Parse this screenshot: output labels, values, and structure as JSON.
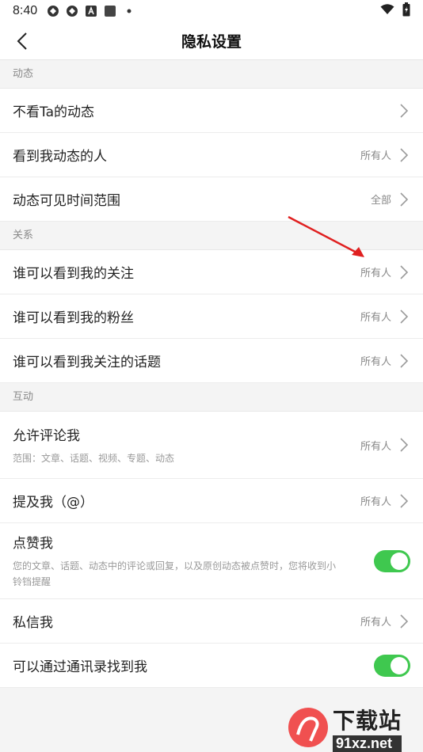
{
  "status": {
    "time": "8:40"
  },
  "nav": {
    "title": "隐私设置"
  },
  "sections": [
    {
      "header": "动态",
      "rows": [
        {
          "label": "不看Ta的动态",
          "value": ""
        },
        {
          "label": "看到我动态的人",
          "value": "所有人"
        },
        {
          "label": "动态可见时间范围",
          "value": "全部"
        }
      ]
    },
    {
      "header": "关系",
      "rows": [
        {
          "label": "谁可以看到我的关注",
          "value": "所有人"
        },
        {
          "label": "谁可以看到我的粉丝",
          "value": "所有人"
        },
        {
          "label": "谁可以看到我关注的话题",
          "value": "所有人"
        }
      ]
    },
    {
      "header": "互动",
      "rows": [
        {
          "label": "允许评论我",
          "sub": "范围：文章、话题、视频、专题、动态",
          "value": "所有人"
        },
        {
          "label": "提及我（@）",
          "value": "所有人"
        },
        {
          "label": "点赞我",
          "sub": "您的文章、话题、动态中的评论或回复，以及原创动态被点赞时，您将收到小铃铛提醒",
          "toggle": true
        },
        {
          "label": "私信我",
          "value": "所有人"
        },
        {
          "label": "可以通过通讯录找到我",
          "toggle": true
        }
      ]
    }
  ],
  "watermark": {
    "brand": "下载站",
    "domain": "91xz.net"
  },
  "colors": {
    "toggle_on": "#3fc84f",
    "annotation_arrow": "#e02020"
  }
}
